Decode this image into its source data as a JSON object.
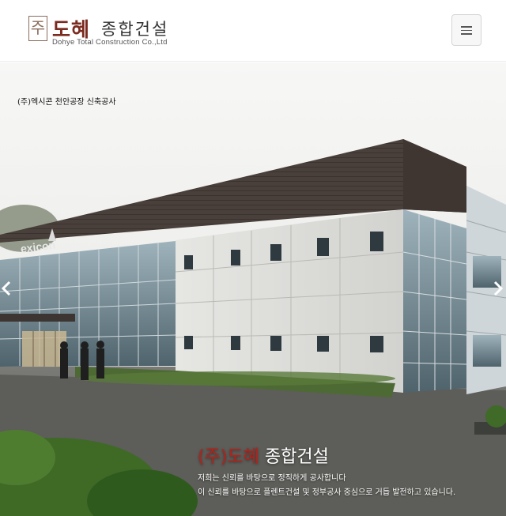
{
  "header": {
    "logo": {
      "seal_char": "주",
      "name_brand": "도혜",
      "name_rest": "종합건설",
      "english": "Dohye Total Construction Co.,Ltd"
    },
    "menu_icon": "hamburger-icon"
  },
  "hero": {
    "slide_title": "(주)엑시콘 천안공장 신축공사",
    "building_sign": "exicon",
    "prev_icon": "chevron-left-icon",
    "next_icon": "chevron-right-icon",
    "caption": {
      "brand": "(주)도혜",
      "rest": " 종합건설",
      "line1": "저희는 신뢰를 바탕으로 정직하게 공사합니다",
      "line2": "이 신뢰를 바탕으로 플렌트건설 및 정부공사 중심으로 거듭 발전하고 있습니다."
    }
  },
  "colors": {
    "brand": "#b5211a",
    "logo_brand": "#7a2a1f",
    "sky": "#f2f2f0",
    "roof": "#4a3f3a"
  }
}
